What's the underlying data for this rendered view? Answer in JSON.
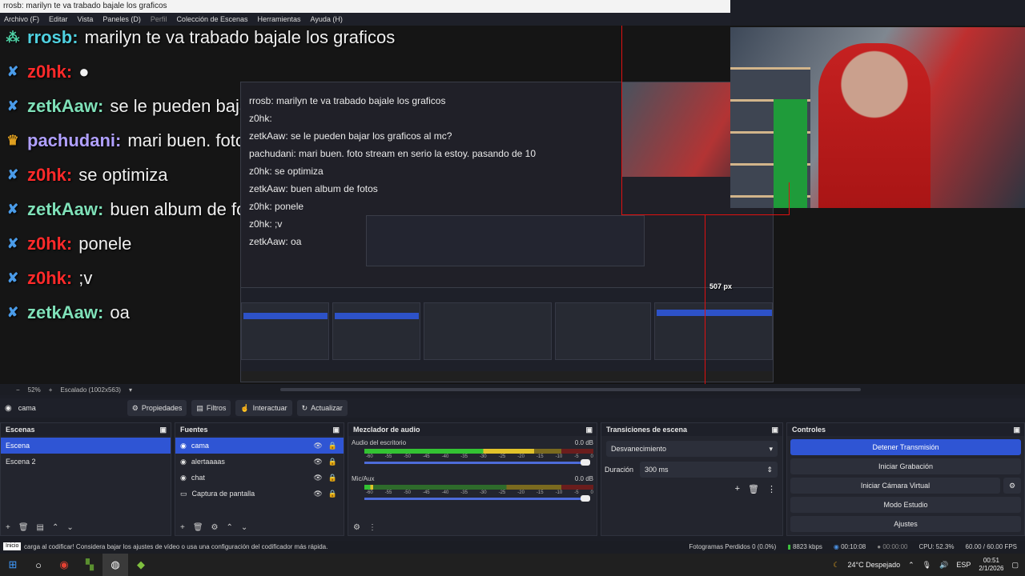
{
  "window": {
    "title": "rrosb: marilyn te va trabado bajale los graficos",
    "menu": [
      "Archivo (F)",
      "Editar",
      "Vista",
      "Paneles (D)",
      "Perfil",
      "Colección de Escenas",
      "Herramientas",
      "Ayuda (H)"
    ]
  },
  "chat": [
    {
      "badge": "⁂",
      "badge_color": "#4fd1a5",
      "user": "rrosb",
      "user_color": "#4fd1e0",
      "message": "marilyn te va trabado bajale los graficos"
    },
    {
      "badge": "✘",
      "badge_color": "#4a9be8",
      "user": "z0hk",
      "user_color": "#ff2a2a",
      "message": "●"
    },
    {
      "badge": "✘",
      "badge_color": "#4a9be8",
      "user": "zetkAaw",
      "user_color": "#7fe0b8",
      "message": "se le pueden bajar los graficos al mc?"
    },
    {
      "badge": "♛",
      "badge_color": "#e0a020",
      "user": "pachudani",
      "user_color": "#b0a0ff",
      "message": "mari buen. foto stream en serio la estoy. pasando de 10"
    },
    {
      "badge": "✘",
      "badge_color": "#4a9be8",
      "user": "z0hk",
      "user_color": "#ff2a2a",
      "message": "se optimiza"
    },
    {
      "badge": "✘",
      "badge_color": "#4a9be8",
      "user": "zetkAaw",
      "user_color": "#7fe0b8",
      "message": "buen album de fotos"
    },
    {
      "badge": "✘",
      "badge_color": "#4a9be8",
      "user": "z0hk",
      "user_color": "#ff2a2a",
      "message": "ponele"
    },
    {
      "badge": "✘",
      "badge_color": "#4a9be8",
      "user": "z0hk",
      "user_color": "#ff2a2a",
      "message": ";v"
    },
    {
      "badge": "✘",
      "badge_color": "#4a9be8",
      "user": "zetkAaw",
      "user_color": "#7fe0b8",
      "message": "oa"
    }
  ],
  "nested_chat": [
    "rrosb: marilyn te va trabado bajale los graficos",
    "z0hk:",
    "zetkAaw: se le pueden bajar los graficos al mc?",
    "pachudani: mari buen. foto stream en serio la estoy. pasando de 10",
    "z0hk: se optimiza",
    "zetkAaw: buen album de fotos",
    "z0hk: ponele",
    "z0hk: ;v",
    "zetkAaw: oa"
  ],
  "measure_label": "507 px",
  "scalebar": {
    "zoom": "52%",
    "scaling": "Escalado (1002x563)"
  },
  "toolbar": {
    "source_name": "cama",
    "properties": "Propiedades",
    "filters": "Filtros",
    "interact": "Interactuar",
    "refresh": "Actualizar"
  },
  "scenes": {
    "title": "Escenas",
    "items": [
      "Escena",
      "Escena 2"
    ]
  },
  "sources": {
    "title": "Fuentes",
    "items": [
      "cama",
      "alertaaaas",
      "chat",
      "Captura de pantalla"
    ]
  },
  "mixer": {
    "title": "Mezclador de audio",
    "channels": [
      {
        "name": "Audio del escritorio",
        "db": "0.0 dB",
        "level": 0.74
      },
      {
        "name": "Mic/Aux",
        "db": "0.0 dB",
        "level": 0.04
      }
    ],
    "ticks": [
      "-60",
      "-55",
      "-50",
      "-45",
      "-40",
      "-35",
      "-30",
      "-25",
      "-20",
      "-15",
      "-10",
      "-5",
      "0"
    ]
  },
  "transitions": {
    "title": "Transiciones de escena",
    "selected": "Desvanecimiento",
    "duration_label": "Duración",
    "duration_value": "300 ms"
  },
  "controls": {
    "title": "Controles",
    "buttons": [
      "Detener Transmisión",
      "Iniciar Grabación",
      "Iniciar Cámara Virtual",
      "Modo Estudio",
      "Ajustes"
    ]
  },
  "status": {
    "tooltip": "Inicio",
    "message": "carga al codificar! Considera bajar los ajustes de vídeo o usa una configuración del codificador más rápida.",
    "dropped": "Fotogramas Perdidos 0 (0.0%)",
    "kbps": "8823 kbps",
    "stream_time": "00:10:08",
    "rec_time": "00:00:00",
    "cpu": "CPU: 52.3%",
    "fps": "60.00 / 60.00 FPS"
  },
  "taskbar": {
    "weather": "24°C  Despejado",
    "lang": "ESP",
    "time": "00:51",
    "date": "2/1/2026"
  }
}
